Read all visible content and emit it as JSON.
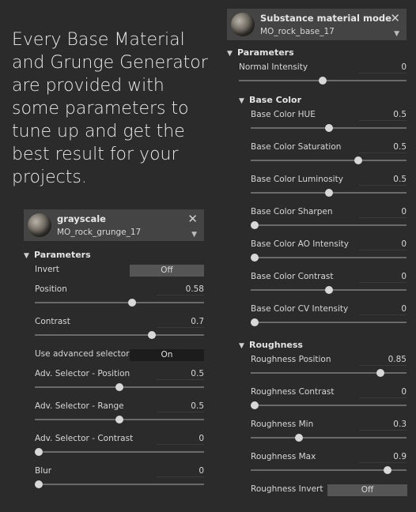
{
  "headline": "Every Base Material and Grunge Generator are provided with some parameters to tune up and get the best result for your projects.",
  "left_panel": {
    "material_name": "grayscale",
    "material_file": "MO_rock_grunge_17",
    "section": "Parameters",
    "invert": {
      "label": "Invert",
      "value": "Off"
    },
    "position": {
      "label": "Position",
      "value": "0.58",
      "level": 0.58
    },
    "contrast": {
      "label": "Contrast",
      "value": "0.7",
      "level": 0.7
    },
    "advanced": {
      "label": "Use advanced selector",
      "value": "On"
    },
    "adv_position": {
      "label": "Adv. Selector - Position",
      "value": "0.5",
      "level": 0.5
    },
    "adv_range": {
      "label": "Adv. Selector - Range",
      "value": "0.5",
      "level": 0.5
    },
    "adv_contrast": {
      "label": "Adv. Selector - Contrast",
      "value": "0",
      "level": 0
    },
    "blur": {
      "label": "Blur",
      "value": "0",
      "level": 0
    }
  },
  "right_panel": {
    "material_name": "Substance material mode",
    "material_file": "MO_rock_base_17",
    "section": "Parameters",
    "normal_intensity": {
      "label": "Normal Intensity",
      "value": "0",
      "level": 0.5
    },
    "base_color": {
      "title": "Base Color",
      "hue": {
        "label": "Base Color HUE",
        "value": "0.5",
        "level": 0.5
      },
      "saturation": {
        "label": "Base Color Saturation",
        "value": "0.5",
        "level": 0.7
      },
      "luminosity": {
        "label": "Base Color Luminosity",
        "value": "0.5",
        "level": 0.5
      },
      "sharpen": {
        "label": "Base Color Sharpen",
        "value": "0",
        "level": 0
      },
      "ao": {
        "label": "Base Color AO Intensity",
        "value": "0",
        "level": 0
      },
      "contrast": {
        "label": "Base Color Contrast",
        "value": "0",
        "level": 0.5
      },
      "cv": {
        "label": "Base Color CV Intensity",
        "value": "0",
        "level": 0
      }
    },
    "roughness": {
      "title": "Roughness",
      "position": {
        "label": "Roughness Position",
        "value": "0.85",
        "level": 0.85
      },
      "contrast": {
        "label": "Roughness Contrast",
        "value": "0",
        "level": 0
      },
      "min": {
        "label": "Roughness Min",
        "value": "0.3",
        "level": 0.3
      },
      "max": {
        "label": "Roughness Max",
        "value": "0.9",
        "level": 0.9
      },
      "invert": {
        "label": "Roughness Invert",
        "value": "Off"
      }
    }
  },
  "icons": {
    "close": "close-icon",
    "chevron": "chevron-down-icon",
    "expand": "expand-triangle-icon"
  }
}
